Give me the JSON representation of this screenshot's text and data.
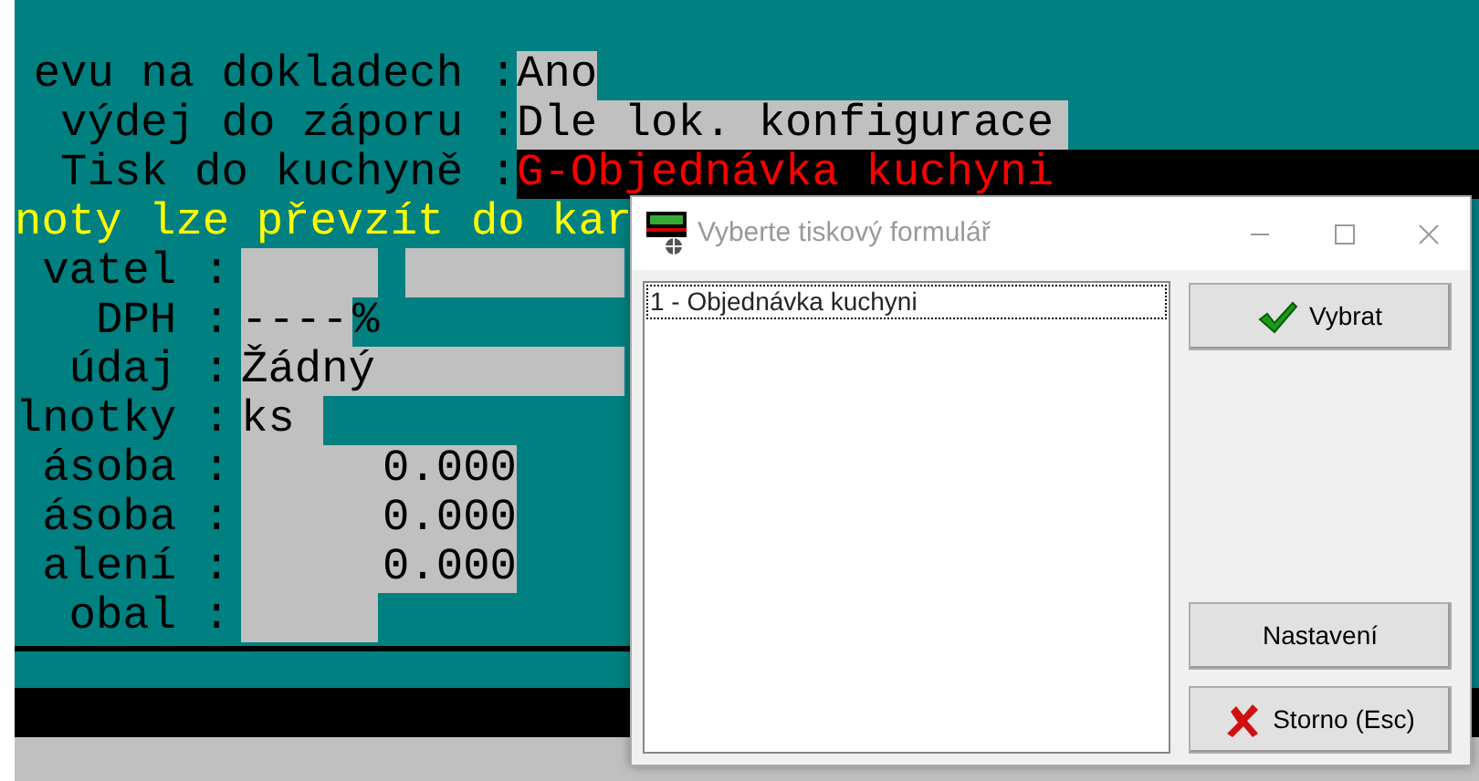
{
  "terminal": {
    "rows": [
      {
        "kind": "field",
        "label": "evu na dokladech :",
        "fields": [
          {
            "value": "Ano",
            "kind": "input"
          }
        ]
      },
      {
        "kind": "field",
        "label": "výdej do záporu :",
        "fields": [
          {
            "value": "Dle lok. konfigurace",
            "kind": "input"
          }
        ]
      },
      {
        "kind": "field",
        "label": "Tisk do kuchyně :",
        "fields": [
          {
            "value": "G-Objednávka kuchyni",
            "kind": "highlight"
          }
        ]
      },
      {
        "kind": "message",
        "text": "noty lze převzít do kar"
      },
      {
        "kind": "field",
        "label": "vatel :",
        "fields": [
          {
            "kind": "input"
          },
          {
            "kind": "input"
          }
        ]
      },
      {
        "kind": "field",
        "label": "DPH :",
        "fields": [
          {
            "value": "----",
            "kind": "input"
          },
          {
            "value": "%",
            "kind": "plain"
          }
        ]
      },
      {
        "kind": "field",
        "label": "údaj :",
        "fields": [
          {
            "value": "Žádný",
            "kind": "input"
          }
        ]
      },
      {
        "kind": "field",
        "label": "lnotky :",
        "fields": [
          {
            "value": "ks",
            "kind": "input"
          }
        ]
      },
      {
        "kind": "field",
        "label": "ásoba :",
        "fields": [
          {
            "value": "0.000",
            "kind": "number"
          }
        ]
      },
      {
        "kind": "field",
        "label": "ásoba :",
        "fields": [
          {
            "value": "0.000",
            "kind": "number"
          }
        ]
      },
      {
        "kind": "field",
        "label": "alení :",
        "fields": [
          {
            "value": "0.000",
            "kind": "number"
          }
        ]
      },
      {
        "kind": "field",
        "label": "obal :",
        "fields": [
          {
            "kind": "input"
          }
        ]
      }
    ]
  },
  "dialog": {
    "title": "Vyberte tiskový formulář",
    "list_items": [
      {
        "label": "1 - Objednávka kuchyni",
        "selected": true
      }
    ],
    "buttons": [
      {
        "label": "Vybrat",
        "kind": "ok"
      },
      {
        "label": "Nastavení",
        "kind": "settings"
      },
      {
        "label": "Storno (Esc)",
        "kind": "cancel"
      }
    ]
  }
}
